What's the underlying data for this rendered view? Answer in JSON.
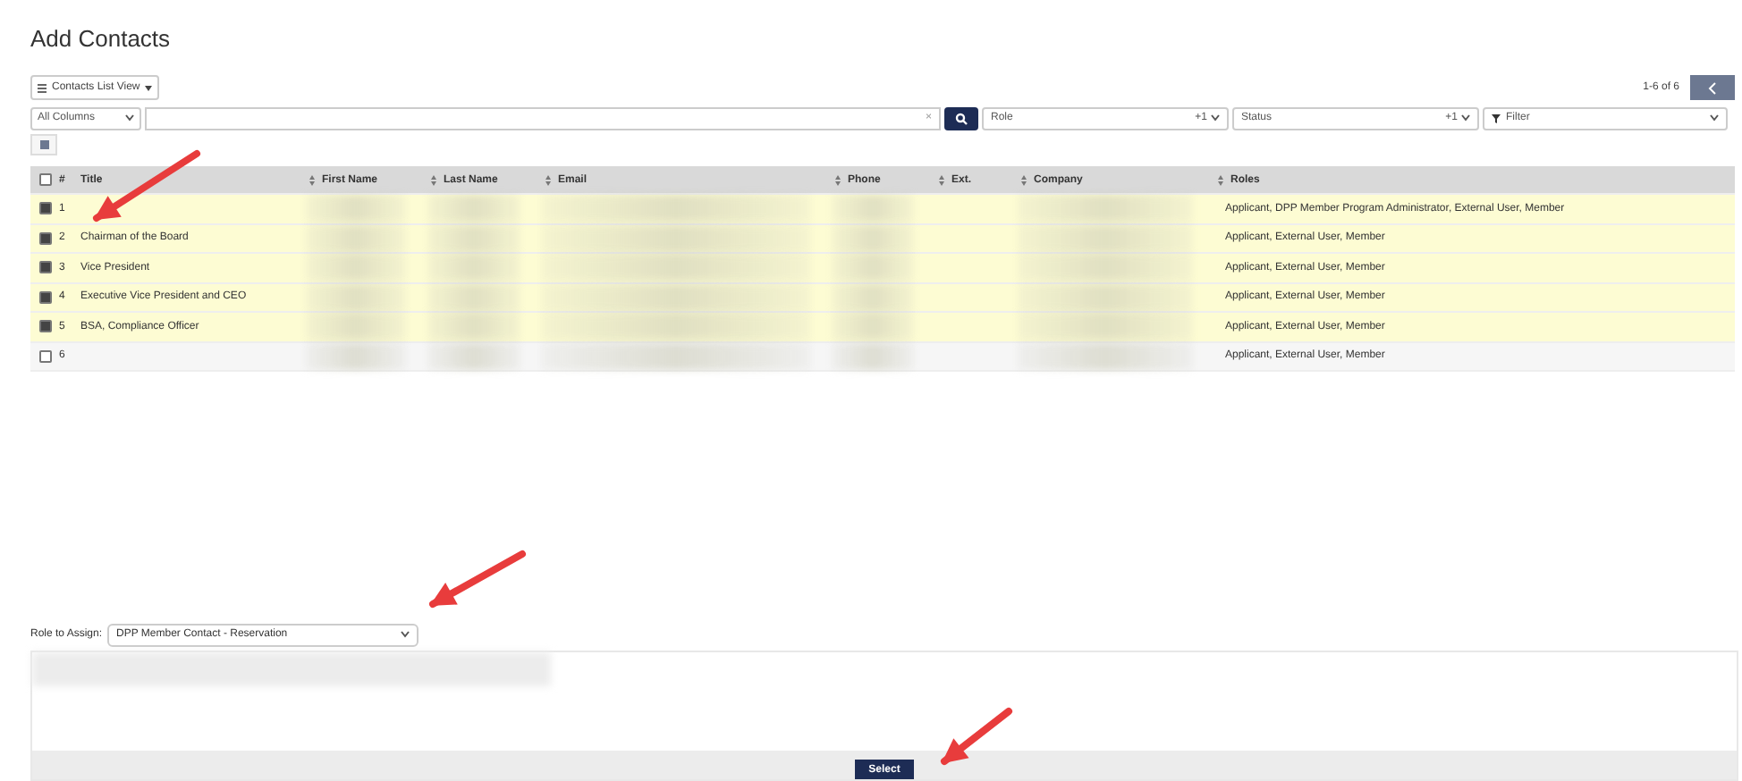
{
  "page_title": "Add Contacts",
  "view_button": "Contacts List View",
  "pager": {
    "range": "1-6 of 6"
  },
  "search": {
    "scope": "All Columns",
    "clear": "×"
  },
  "filters": [
    {
      "label": "Role",
      "suffix": "+1"
    },
    {
      "label": "Status",
      "suffix": "+1"
    }
  ],
  "filter_menu": "Filter",
  "table": {
    "all_selected": false,
    "columns": [
      {
        "label": "#",
        "sortable": false,
        "redacted": false
      },
      {
        "label": "Title",
        "sortable": false,
        "redacted": false
      },
      {
        "label": "First Name",
        "sortable": true,
        "redacted": true
      },
      {
        "label": "Last Name",
        "sortable": true,
        "redacted": true
      },
      {
        "label": "Email",
        "sortable": true,
        "redacted": true
      },
      {
        "label": "Phone",
        "sortable": true,
        "redacted": true
      },
      {
        "label": "Ext.",
        "sortable": true,
        "redacted": false
      },
      {
        "label": "Company",
        "sortable": true,
        "redacted": true
      },
      {
        "label": "Roles",
        "sortable": true,
        "redacted": false
      }
    ],
    "rows": [
      {
        "selected": true,
        "number": "1",
        "title": "",
        "roles": "Applicant, DPP Member Program Administrator, External User, Member"
      },
      {
        "selected": true,
        "number": "2",
        "title": "Chairman of the Board",
        "roles": "Applicant, External User, Member"
      },
      {
        "selected": true,
        "number": "3",
        "title": "Vice President",
        "roles": "Applicant, External User, Member"
      },
      {
        "selected": true,
        "number": "4",
        "title": "Executive Vice President and CEO",
        "roles": "Applicant, External User, Member"
      },
      {
        "selected": true,
        "number": "5",
        "title": "BSA, Compliance Officer",
        "roles": "Applicant, External User, Member"
      },
      {
        "selected": false,
        "number": "6",
        "title": "",
        "roles": "Applicant, External User, Member"
      }
    ]
  },
  "role_assign": {
    "label": "Role to Assign:",
    "value": "DPP Member Contact - Reservation"
  },
  "select_button": "Select"
}
